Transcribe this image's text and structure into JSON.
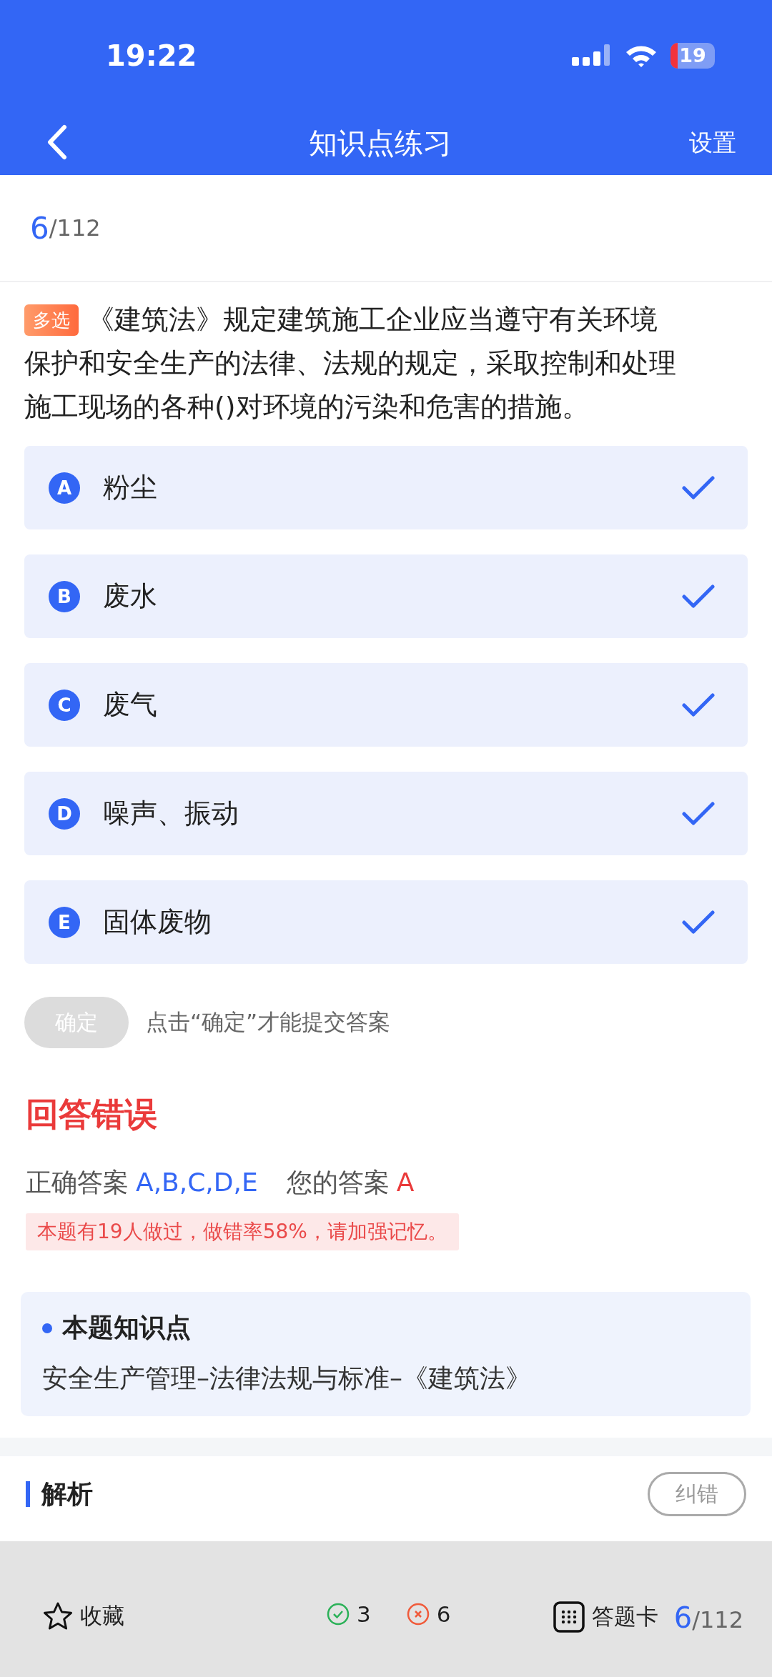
{
  "status_bar": {
    "time": "19:22",
    "battery": "19"
  },
  "nav": {
    "title": "知识点练习",
    "action": "设置"
  },
  "progress": {
    "current": "6",
    "total": "/112"
  },
  "question": {
    "type_tag": "多选",
    "lines": [
      "《建筑法》规定建筑施工企业应当遵守有关环境",
      "保护和安全生产的法律、法规的规定，采取控制和处理",
      "施工现场的各种()对环境的污染和危害的措施。"
    ]
  },
  "options": [
    {
      "letter": "A",
      "text": "粉尘",
      "checked": true
    },
    {
      "letter": "B",
      "text": "废水",
      "checked": true
    },
    {
      "letter": "C",
      "text": "废气",
      "checked": true
    },
    {
      "letter": "D",
      "text": "噪声、振动",
      "checked": true
    },
    {
      "letter": "E",
      "text": "固体废物",
      "checked": true
    }
  ],
  "confirm": {
    "label": "确定",
    "disabled": true,
    "hint": "点击“确定”才能提交答案"
  },
  "result": {
    "title": "回答错误",
    "correct_label": "正确答案",
    "correct_value": "A,B,C,D,E",
    "your_label": "您的答案",
    "your_value": "A",
    "stat": "本题有19人做过，做错率58%，请加强记忆。"
  },
  "knowledge": {
    "title": "本题知识点",
    "text": "安全生产管理–法律法规与标准–《建筑法》"
  },
  "analysis": {
    "title": "解析",
    "report": "纠错"
  },
  "bottom_bar": {
    "favorite": "收藏",
    "right_count": "3",
    "wrong_count": "6",
    "card": "答题卡",
    "current": "6",
    "total": "/112"
  }
}
